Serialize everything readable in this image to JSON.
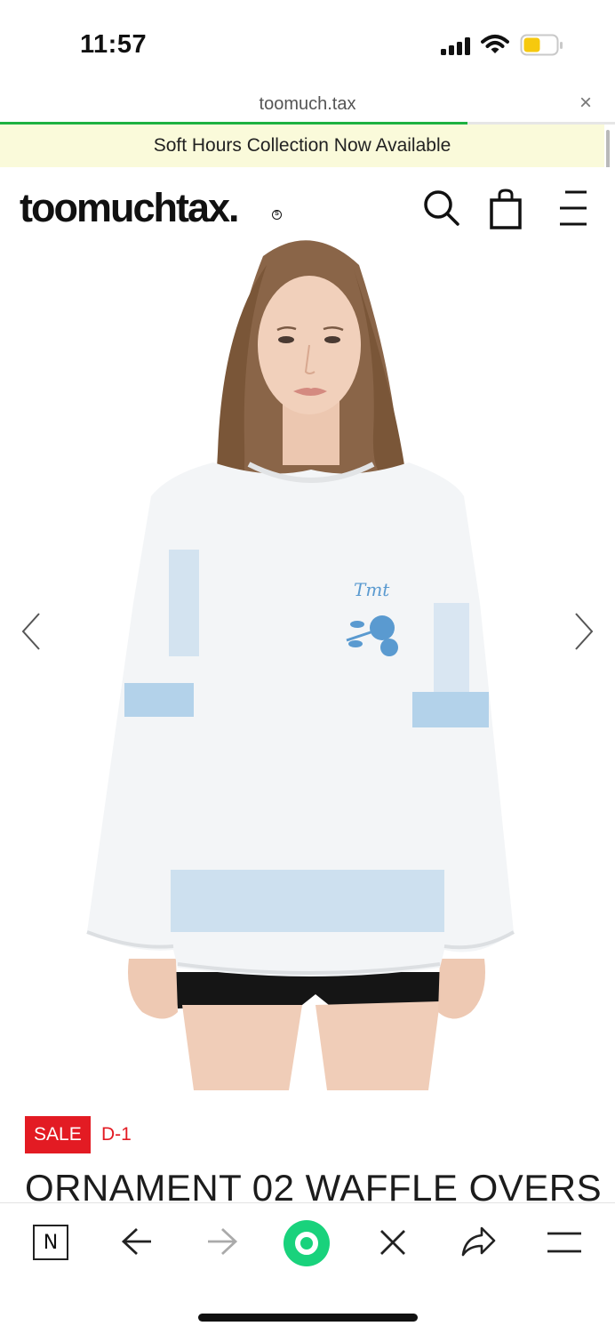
{
  "status_bar": {
    "time": "11:57"
  },
  "browser": {
    "url": "toomuch.tax",
    "close_glyph": "×",
    "load_progress": 0.76
  },
  "announcement": "Soft Hours Collection Now Available",
  "header": {
    "logo": "toomuchtax.",
    "logo_mark": "S",
    "icons": [
      "search-icon",
      "shopping-bag-icon",
      "menu-icon"
    ]
  },
  "hero": {
    "embroidery_text": "Tmt",
    "icons": [
      "chevron-left-icon",
      "chevron-right-icon"
    ]
  },
  "product": {
    "badge": "SALE",
    "countdown": "D-1",
    "title": "ORNAMENT 02 WAFFLE OVERS"
  },
  "toolbar": {
    "naver_label": "N",
    "icons": [
      "naver-icon",
      "back-icon",
      "forward-icon",
      "green-dot-icon",
      "close-icon",
      "share-icon",
      "menu-icon"
    ]
  },
  "colors": {
    "accent_sale": "#e31b23",
    "progress": "#1db140",
    "announcement_bg": "#fafada",
    "green_button": "#19d27c"
  }
}
